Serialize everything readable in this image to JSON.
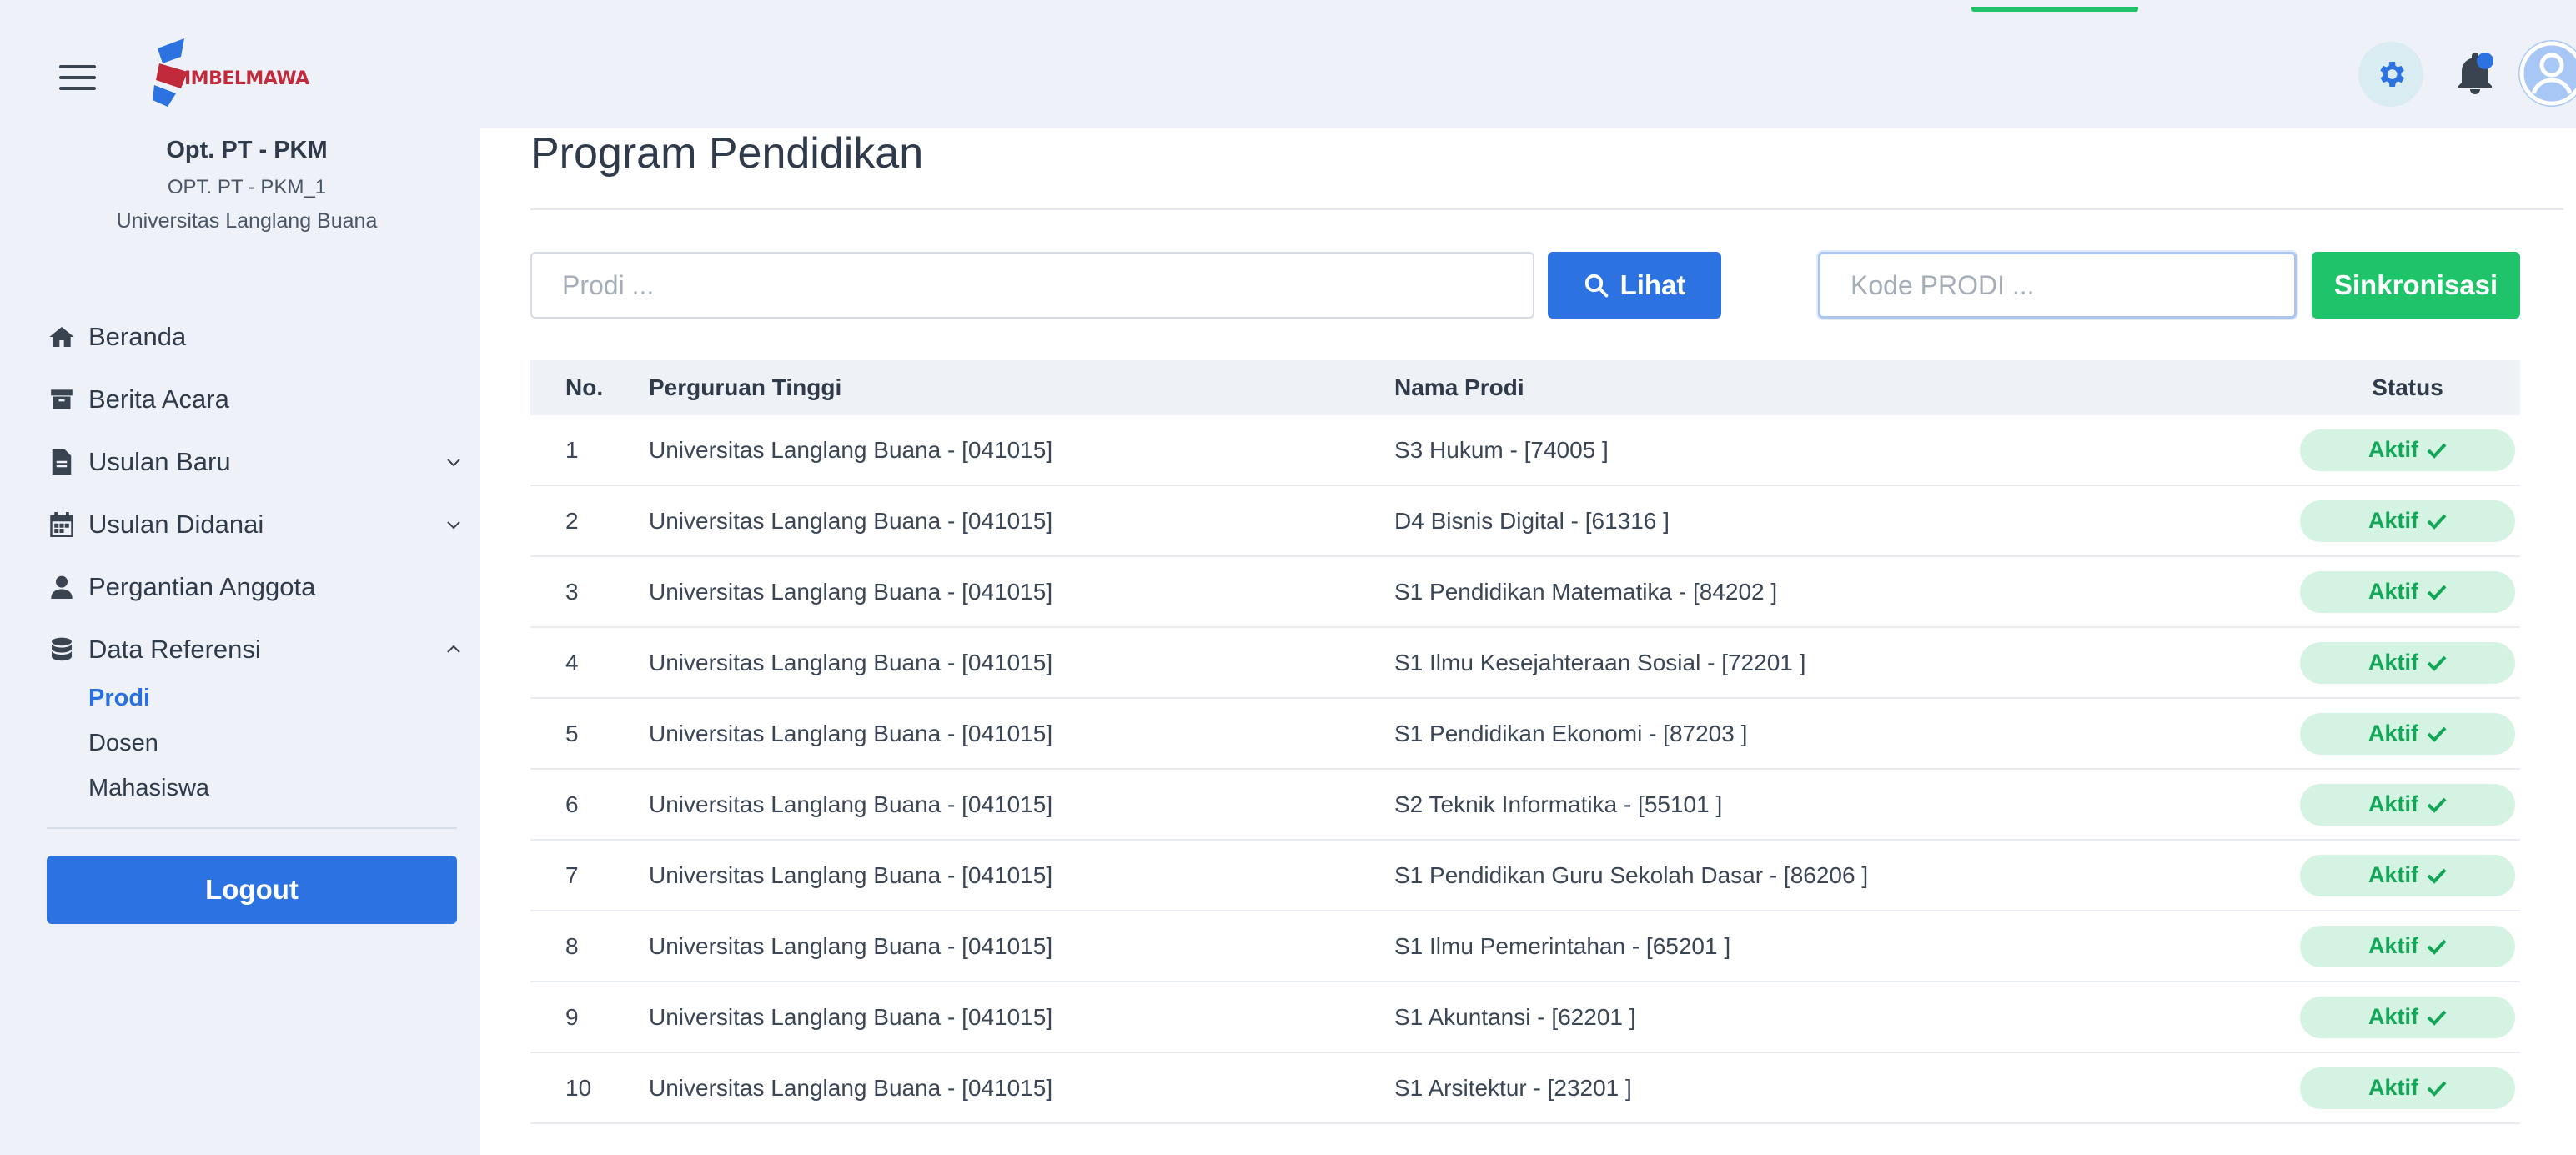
{
  "header": {
    "logo_text": "IMBELMAWA",
    "logo_letter": "S"
  },
  "sidebar": {
    "role": "Opt. PT - PKM",
    "username": "OPT. PT - PKM_1",
    "university": "Universitas Langlang Buana",
    "menu": [
      {
        "label": "Beranda",
        "icon": "home-icon"
      },
      {
        "label": "Berita Acara",
        "icon": "archive-icon"
      },
      {
        "label": "Usulan Baru",
        "icon": "file-icon",
        "expandable": true
      },
      {
        "label": "Usulan Didanai",
        "icon": "calendar-icon",
        "expandable": true
      },
      {
        "label": "Pergantian Anggota",
        "icon": "user-icon"
      },
      {
        "label": "Data Referensi",
        "icon": "database-icon",
        "expanded": true
      }
    ],
    "submenu": [
      {
        "label": "Prodi",
        "active": true
      },
      {
        "label": "Dosen"
      },
      {
        "label": "Mahasiswa"
      }
    ],
    "logout_label": "Logout"
  },
  "main": {
    "title": "Program Pendidikan",
    "prodi_placeholder": "Prodi ...",
    "lihat_label": "Lihat",
    "kode_placeholder": "Kode PRODI ...",
    "sinkron_label": "Sinkronisasi",
    "columns": [
      "No.",
      "Perguruan Tinggi",
      "Nama Prodi",
      "Status"
    ],
    "rows": [
      {
        "no": "1",
        "pt": "Universitas Langlang Buana - [041015]",
        "prodi": "S3 Hukum - [74005 ]",
        "status": "Aktif"
      },
      {
        "no": "2",
        "pt": "Universitas Langlang Buana - [041015]",
        "prodi": "D4 Bisnis Digital - [61316 ]",
        "status": "Aktif"
      },
      {
        "no": "3",
        "pt": "Universitas Langlang Buana - [041015]",
        "prodi": "S1 Pendidikan Matematika - [84202 ]",
        "status": "Aktif"
      },
      {
        "no": "4",
        "pt": "Universitas Langlang Buana - [041015]",
        "prodi": "S1 Ilmu Kesejahteraan Sosial - [72201 ]",
        "status": "Aktif"
      },
      {
        "no": "5",
        "pt": "Universitas Langlang Buana - [041015]",
        "prodi": "S1 Pendidikan Ekonomi - [87203 ]",
        "status": "Aktif"
      },
      {
        "no": "6",
        "pt": "Universitas Langlang Buana - [041015]",
        "prodi": "S2 Teknik Informatika - [55101 ]",
        "status": "Aktif"
      },
      {
        "no": "7",
        "pt": "Universitas Langlang Buana - [041015]",
        "prodi": "S1 Pendidikan Guru Sekolah Dasar - [86206 ]",
        "status": "Aktif"
      },
      {
        "no": "8",
        "pt": "Universitas Langlang Buana - [041015]",
        "prodi": "S1 Ilmu Pemerintahan - [65201 ]",
        "status": "Aktif"
      },
      {
        "no": "9",
        "pt": "Universitas Langlang Buana - [041015]",
        "prodi": "S1 Akuntansi - [62201 ]",
        "status": "Aktif"
      },
      {
        "no": "10",
        "pt": "Universitas Langlang Buana - [041015]",
        "prodi": "S1 Arsitektur - [23201 ]",
        "status": "Aktif"
      }
    ]
  },
  "colors": {
    "primary": "#2c72e0",
    "success": "#1ec36a",
    "badge_bg": "#d5f3e3",
    "badge_text": "#12a657",
    "background": "#eef2f8"
  }
}
